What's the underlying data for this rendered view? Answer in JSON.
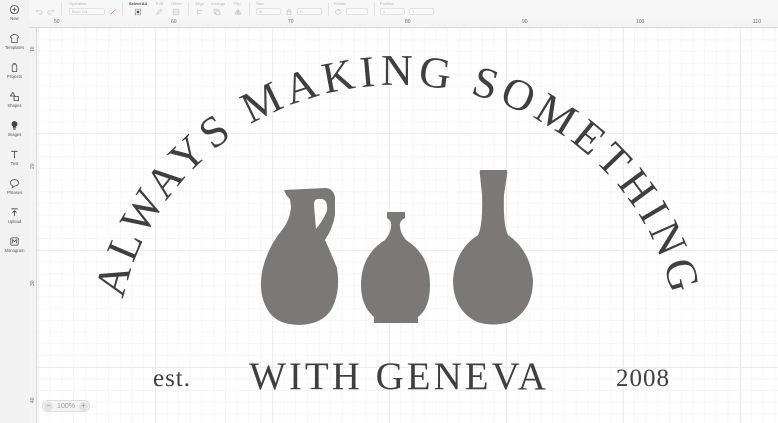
{
  "sidebar": {
    "items": [
      {
        "label": "New",
        "icon": "plus-circle-icon"
      },
      {
        "label": "Templates",
        "icon": "shirt-icon"
      },
      {
        "label": "Projects",
        "icon": "projects-icon"
      },
      {
        "label": "Shapes",
        "icon": "shapes-icon"
      },
      {
        "label": "Images",
        "icon": "lightbulb-icon"
      },
      {
        "label": "Text",
        "icon": "text-icon"
      },
      {
        "label": "Phrases",
        "icon": "speech-bubble-icon"
      },
      {
        "label": "Upload",
        "icon": "upload-icon"
      },
      {
        "label": "Monogram",
        "icon": "monogram-icon"
      }
    ]
  },
  "toolbar": {
    "operation_label": "Operation",
    "operation_value": "Basic Cut",
    "select_all_label": "Select All",
    "edit_label": "Edit",
    "offset_label": "Offset",
    "align_label": "Align",
    "arrange_label": "Arrange",
    "flip_label": "Flip",
    "size_label": "Size",
    "size_w": "W",
    "size_h": "H",
    "rotate_label": "Rotate",
    "position_label": "Position",
    "pos_x": "X",
    "pos_y": "Y"
  },
  "ruler": {
    "top_labels": [
      "50",
      "60",
      "70",
      "80",
      "90",
      "100",
      "110"
    ],
    "left_labels": [
      "10",
      "20",
      "30",
      "40"
    ]
  },
  "design": {
    "arc_text": "ALWAYS MAKING SOMETHING",
    "main_text": "WITH GENEVA",
    "est_text": "est.",
    "year_text": "2008",
    "vase_color": "#7d7878",
    "text_color": "#3f3f3f"
  },
  "zoom": {
    "minus": "−",
    "value": "100%",
    "plus": "+"
  }
}
